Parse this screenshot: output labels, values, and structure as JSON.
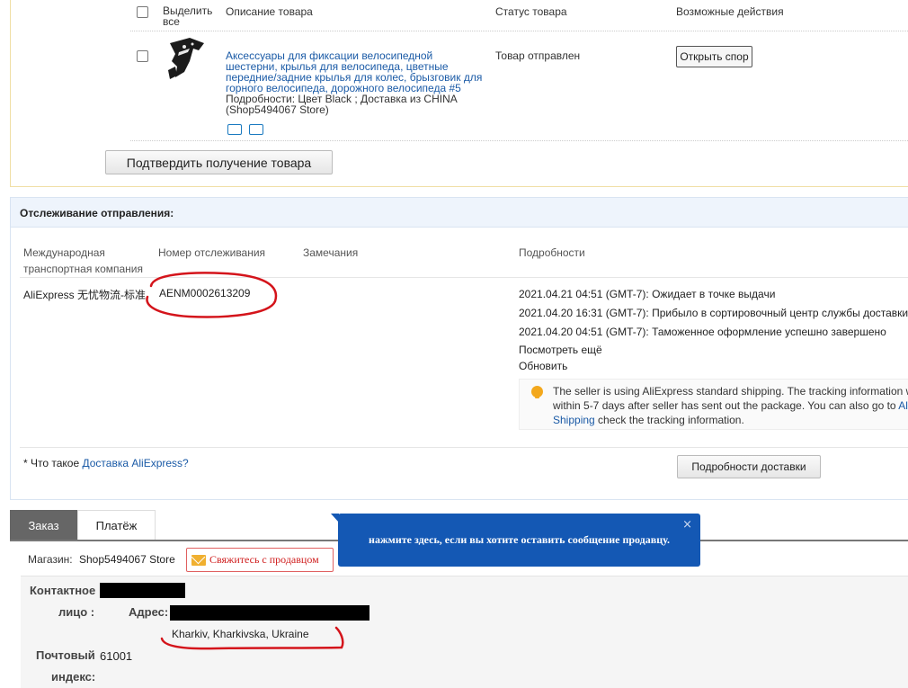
{
  "items_table": {
    "select_all_label": "Выделить все",
    "headers": {
      "description": "Описание товара",
      "status": "Статус товара",
      "actions": "Возможные действия"
    },
    "product": {
      "title": "Аксессуары для фиксации велосипедной шестерни, крылья для велосипеда, цветные передние/задние крылья для колес, брызговик для горного велосипеда, дорожного велосипеда #5",
      "details": "Подробности: Цвет Black    ; Доставка из CHINA (Shop5494067 Store)",
      "status": "Товар отправлен",
      "dispute_button": "Открыть спор"
    },
    "confirm_button": "Подтвердить получение товара"
  },
  "tracking": {
    "title": "Отслеживание отправления:",
    "columns": {
      "carrier": "Международная транспортная компания",
      "number": "Номер отслеживания",
      "remarks": "Замечания",
      "details": "Подробности"
    },
    "carrier": "AliExpress 无忧物流-标准",
    "tracking_number": "AENM0002613209",
    "events": [
      "2021.04.21 04:51 (GMT-7): Ожидает в точке выдачи",
      "2021.04.20 16:31 (GMT-7): Прибыло в сортировочный центр службы доставки",
      "2021.04.20 04:51 (GMT-7): Таможенное оформление успешно завершено"
    ],
    "see_more": "Посмотреть ещё",
    "refresh": "Обновить",
    "notice": {
      "line1": "The seller is using AliExpress standard shipping. The tracking information w",
      "line2_prefix": "within 5-7 days after seller has sent out the package. You can also go to ",
      "line2_link": "Ali",
      "line3_link": "Shipping",
      "line3_suffix": " check the tracking information."
    },
    "footnote_prefix": "* Что такое ",
    "footnote_link": "Доставка AliExpress?",
    "delivery_details_button": "Подробности доставки"
  },
  "order_tabs": {
    "order": "Заказ",
    "payment": "Платёж"
  },
  "store": {
    "label": "Магазин:",
    "name": "Shop5494067 Store",
    "contact_button": "Свяжитесь с продавцом"
  },
  "tooltip": {
    "text": "нажмите здесь, если вы хотите оставить сообщение продавцу.",
    "close": "×"
  },
  "contact_info": {
    "contact_person_label_1": "Контактное",
    "contact_person_label_2": "лицо :",
    "address_label": "Адрес:",
    "address_line": "Kharkiv, Kharkivska, Ukraine",
    "postal_label_1": "Почтовый",
    "postal_label_2": "индекс:",
    "postal_code": "61001"
  },
  "colors": {
    "link": "#1a5aa6",
    "tooltip_bg": "#1458b4",
    "annotation_ink": "#d4141b"
  }
}
